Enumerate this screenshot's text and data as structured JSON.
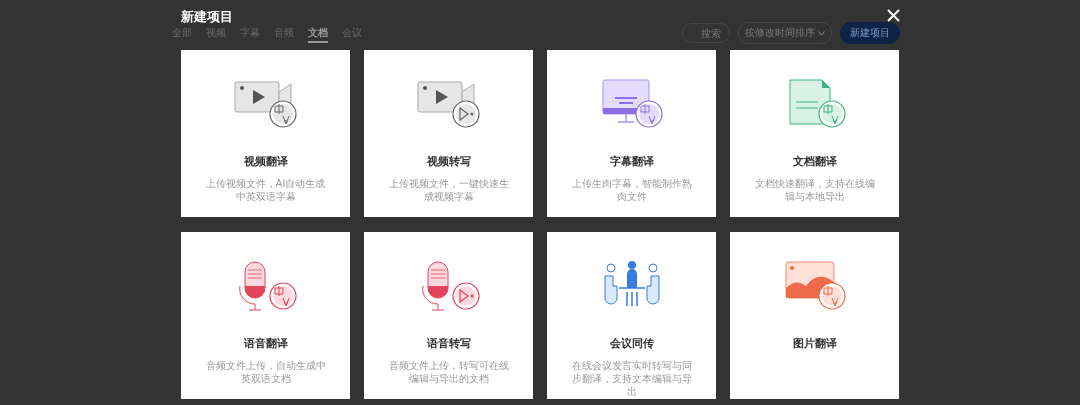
{
  "background_page": {
    "tabs": [
      {
        "label": "全部",
        "selected": false
      },
      {
        "label": "视频",
        "selected": false
      },
      {
        "label": "字幕",
        "selected": false
      },
      {
        "label": "音频",
        "selected": false
      },
      {
        "label": "文档",
        "selected": true
      },
      {
        "label": "会议",
        "selected": false
      }
    ],
    "search": {
      "placeholder": "搜索"
    },
    "sort": {
      "label": "按修改时间排序"
    },
    "new_button": "新建项目"
  },
  "dialog": {
    "title": "新建项目",
    "cards": [
      {
        "kind": "video_translate",
        "title": "视频翻译",
        "description": "上传视频文件，AI自动生成中英双语字幕"
      },
      {
        "kind": "video_transcribe",
        "title": "视频转写",
        "description": "上传视频文件，一键快速生成视频字幕"
      },
      {
        "kind": "subtitle_translate",
        "title": "字幕翻译",
        "description": "上传生肉字幕，智能制作熟肉文件"
      },
      {
        "kind": "document_translate",
        "title": "文档翻译",
        "description": "文档快速翻译，支持在线编辑与本地导出"
      },
      {
        "kind": "audio_translate",
        "title": "语音翻译",
        "description": "音频文件上传，自动生成中英双语文档"
      },
      {
        "kind": "audio_transcribe",
        "title": "语音转写",
        "description": "音频文件上传，转写可在线编辑与导出的文档"
      },
      {
        "kind": "meeting",
        "title": "会议同传",
        "description": "在线会议发言实时转写与同步翻译，支持文本编辑与导出"
      },
      {
        "kind": "image_translate",
        "title": "图片翻译"
      }
    ]
  }
}
